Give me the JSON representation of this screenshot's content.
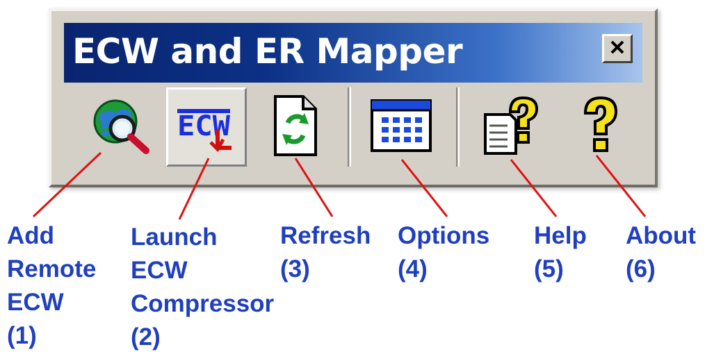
{
  "window": {
    "title": "ECW and ER Mapper",
    "close_glyph": "×"
  },
  "toolbar": {
    "buttons": [
      {
        "icon": "globe-search-icon",
        "pressed": false
      },
      {
        "icon": "ecw-compressor-icon",
        "pressed": true
      },
      {
        "icon": "refresh-document-icon",
        "pressed": false
      },
      {
        "icon": "options-grid-icon",
        "pressed": false
      },
      {
        "icon": "help-document-icon",
        "pressed": false
      },
      {
        "icon": "about-question-icon",
        "pressed": false
      }
    ]
  },
  "callouts": [
    {
      "line1": "Add",
      "line2": "Remote",
      "line3": "ECW",
      "line4": "(1)"
    },
    {
      "line1": "Launch",
      "line2": "ECW",
      "line3": "Compressor",
      "line4": "(2)"
    },
    {
      "line1": "Refresh",
      "line2": "(3)"
    },
    {
      "line1": "Options",
      "line2": "(4)"
    },
    {
      "line1": "Help",
      "line2": "(5)"
    },
    {
      "line1": "About",
      "line2": "(6)"
    }
  ],
  "colors": {
    "label_text": "#1f3fc0",
    "leader_lines": "#e01010",
    "title_bar_start": "#0a2470",
    "title_bar_end": "#a7c4ec",
    "window_face": "#d4d0c8"
  }
}
